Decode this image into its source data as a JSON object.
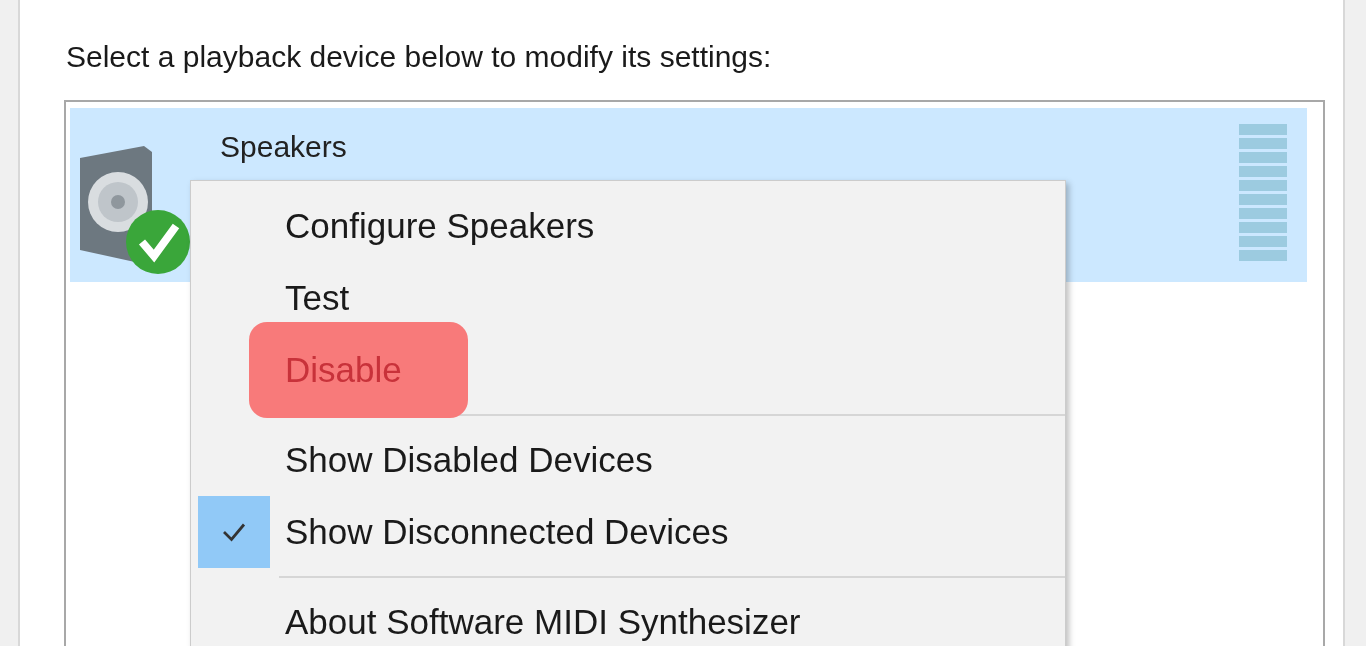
{
  "instruction": "Select a playback device below to modify its settings:",
  "devices": [
    {
      "name": "Speakers",
      "selected": true,
      "default": true
    }
  ],
  "context_menu": {
    "items": [
      {
        "kind": "item",
        "label": "Configure Speakers",
        "checked": false,
        "highlighted": false
      },
      {
        "kind": "item",
        "label": "Test",
        "checked": false,
        "highlighted": false
      },
      {
        "kind": "item",
        "label": "Disable",
        "checked": false,
        "highlighted": true
      },
      {
        "kind": "separator"
      },
      {
        "kind": "item",
        "label": "Show Disabled Devices",
        "checked": false,
        "highlighted": false
      },
      {
        "kind": "item",
        "label": "Show Disconnected Devices",
        "checked": true,
        "highlighted": false
      },
      {
        "kind": "separator"
      },
      {
        "kind": "item",
        "label": "About Software MIDI Synthesizer",
        "checked": false,
        "highlighted": false
      }
    ]
  }
}
